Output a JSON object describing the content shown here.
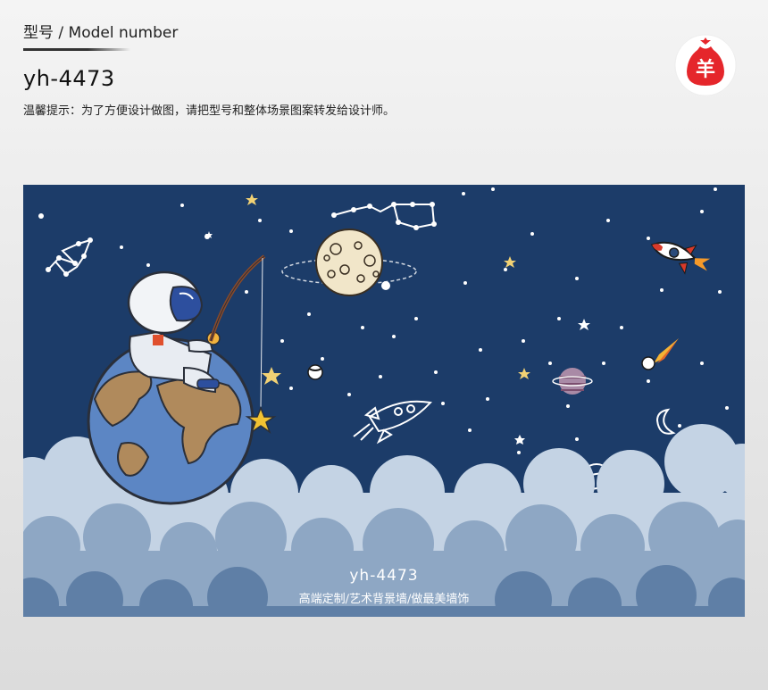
{
  "header": {
    "model_label": "型号 / Model number",
    "model_number": "yh-4473",
    "tip": "温馨提示：为了方便设计做图，请把型号和整体场景图案转发给设计师。"
  },
  "logo": {
    "icon": "red-sheep-bag-logo-icon",
    "glyph": "羊",
    "color": "#e5262b"
  },
  "scene": {
    "caption_code": "yh-4473",
    "caption_sub": "高端定制/艺术背景墙/做最美墙饰",
    "colors": {
      "sky": "#1c3c69",
      "cloud_light": "#c4d3e4",
      "cloud_mid": "#8ea7c4",
      "cloud_dark": "#5f7fa6"
    }
  }
}
